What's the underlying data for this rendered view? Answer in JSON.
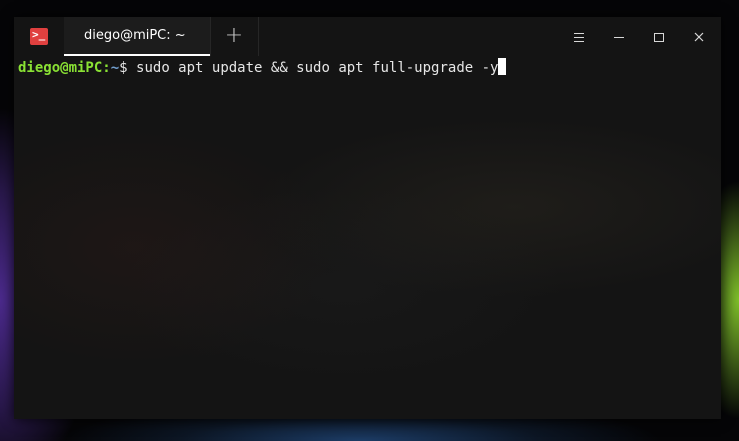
{
  "tab": {
    "title": "diego@miPC: ~",
    "new_tab_icon": "+"
  },
  "app_icon": {
    "glyph": ">_",
    "name": "terminal-icon"
  },
  "window_controls": {
    "menu": "menu-icon",
    "minimize": "minimize-icon",
    "maximize": "maximize-icon",
    "close": "close-icon"
  },
  "terminal": {
    "prompt_user": "diego@miPC",
    "prompt_colon": ":",
    "prompt_path": "~",
    "prompt_symbol": "$",
    "command": " sudo apt update && sudo apt full-upgrade -y"
  },
  "colors": {
    "app_icon_bg": "#e0403f",
    "prompt_user": "#8ae234",
    "prompt_path": "#729fcf",
    "window_bg": "#141414"
  }
}
